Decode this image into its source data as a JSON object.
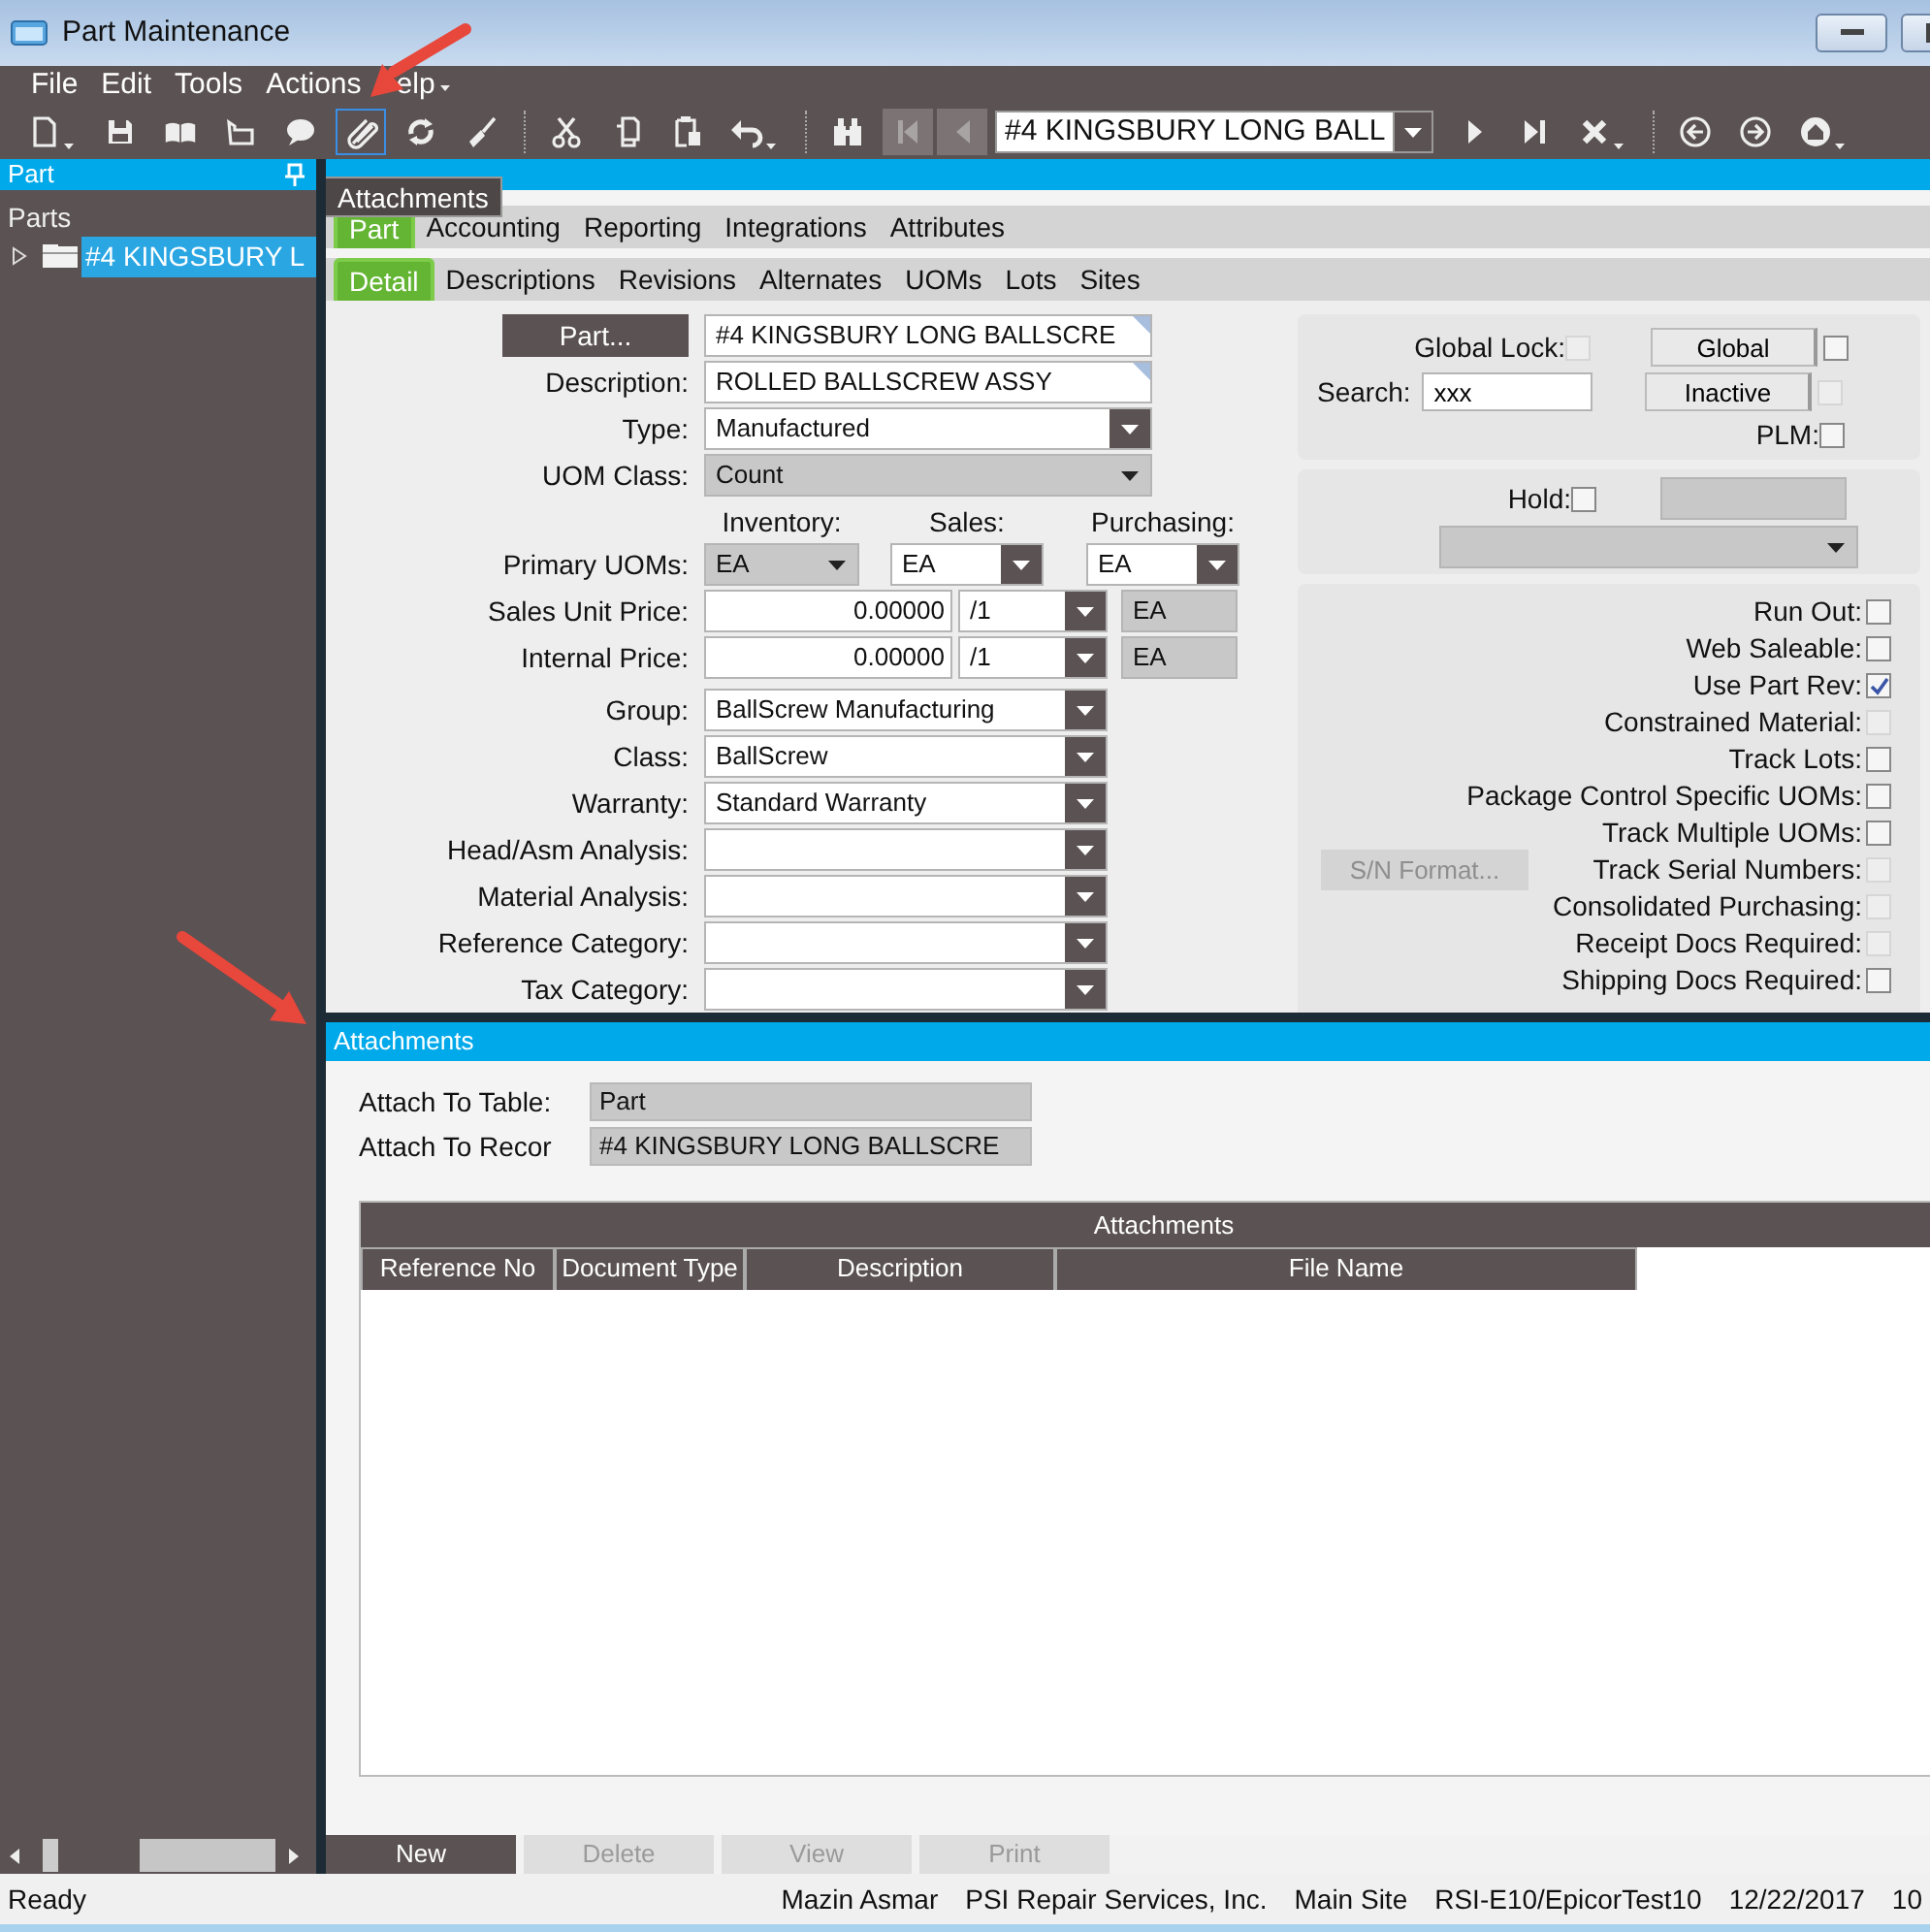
{
  "window": {
    "title": "Part Maintenance"
  },
  "menu": [
    "File",
    "Edit",
    "Tools",
    "Actions",
    "elp"
  ],
  "toolbar": {
    "tooltip": "Attachments",
    "groups": [
      [
        {
          "kind": "new",
          "has_menu": true,
          "selected": false,
          "disabled": false
        },
        {
          "kind": "save",
          "has_menu": false,
          "selected": false,
          "disabled": false
        },
        {
          "kind": "book",
          "has_menu": false,
          "selected": false,
          "disabled": false
        },
        {
          "kind": "folder",
          "has_menu": false,
          "selected": false,
          "disabled": false
        },
        {
          "kind": "comment",
          "has_menu": false,
          "selected": false,
          "disabled": false
        },
        {
          "kind": "attach",
          "has_menu": false,
          "selected": true,
          "disabled": false
        },
        {
          "kind": "refresh",
          "has_menu": false,
          "selected": false,
          "disabled": false
        },
        {
          "kind": "clear",
          "has_menu": false,
          "selected": false,
          "disabled": false
        }
      ],
      [
        {
          "kind": "cut",
          "has_menu": false,
          "selected": false,
          "disabled": false
        },
        {
          "kind": "copy",
          "has_menu": false,
          "selected": false,
          "disabled": false
        },
        {
          "kind": "paste",
          "has_menu": false,
          "selected": false,
          "disabled": false
        },
        {
          "kind": "undo",
          "has_menu": true,
          "selected": false,
          "disabled": false
        }
      ],
      [
        {
          "kind": "search",
          "has_menu": false,
          "selected": false,
          "disabled": false
        },
        {
          "kind": "first",
          "has_menu": false,
          "selected": false,
          "disabled": true
        },
        {
          "kind": "prev",
          "has_menu": false,
          "selected": false,
          "disabled": true
        },
        {
          "kind": "record",
          "value": "#4 KINGSBURY LONG BALL"
        },
        {
          "kind": "next",
          "has_menu": false,
          "selected": false,
          "disabled": false
        },
        {
          "kind": "last",
          "has_menu": false,
          "selected": false,
          "disabled": false
        },
        {
          "kind": "delete",
          "has_menu": true,
          "selected": false,
          "disabled": false
        }
      ],
      [
        {
          "kind": "back",
          "has_menu": false,
          "selected": false,
          "disabled": false
        },
        {
          "kind": "forward",
          "has_menu": false,
          "selected": false,
          "disabled": false
        },
        {
          "kind": "home",
          "has_menu": true,
          "selected": false,
          "disabled": false
        }
      ]
    ]
  },
  "sidebar": {
    "title": "Part",
    "tree_title": "Parts",
    "tree": [
      {
        "label": "#4 KINGSBURY L",
        "selected": true,
        "expanded": false
      }
    ]
  },
  "form": {
    "tabs": [
      {
        "label": "Part",
        "selected": true
      },
      {
        "label": "Accounting",
        "selected": false
      },
      {
        "label": "Reporting",
        "selected": false
      },
      {
        "label": "Integrations",
        "selected": false
      },
      {
        "label": "Attributes",
        "selected": false
      }
    ],
    "subtabs": [
      {
        "label": "Detail",
        "selected": true
      },
      {
        "label": "Descriptions",
        "selected": false
      },
      {
        "label": "Revisions",
        "selected": false
      },
      {
        "label": "Alternates",
        "selected": false
      },
      {
        "label": "UOMs",
        "selected": false
      },
      {
        "label": "Lots",
        "selected": false
      },
      {
        "label": "Sites",
        "selected": false
      }
    ],
    "fields": [
      {
        "kind": "button",
        "label": "Part...",
        "value": "#4 KINGSBURY LONG BALLSCRE"
      },
      {
        "kind": "text",
        "label": "Description:",
        "value": "ROLLED BALLSCREW ASSY"
      },
      {
        "kind": "combo",
        "label": "Type:",
        "value": "Manufactured"
      },
      {
        "kind": "readonly-combo",
        "label": "UOM Class:",
        "value": "Count"
      }
    ],
    "uoms": {
      "label": "Primary UOMs:",
      "columns": [
        {
          "heading": "Inventory:",
          "value": "EA",
          "readonly": true
        },
        {
          "heading": "Sales:",
          "value": "EA",
          "readonly": false
        },
        {
          "heading": "Purchasing:",
          "value": "EA",
          "readonly": false
        }
      ]
    },
    "prices": [
      {
        "label": "Sales Unit Price:",
        "amount": "0.00000",
        "per": "/1",
        "uom": "EA"
      },
      {
        "label": "Internal Price:",
        "amount": "0.00000",
        "per": "/1",
        "uom": "EA"
      }
    ],
    "more_fields": [
      {
        "kind": "combo",
        "label": "Group:",
        "value": "BallScrew Manufacturing"
      },
      {
        "kind": "combo",
        "label": "Class:",
        "value": "BallScrew"
      },
      {
        "kind": "combo",
        "label": "Warranty:",
        "value": "Standard Warranty"
      },
      {
        "kind": "combo",
        "label": "Head/Asm Analysis:"
      },
      {
        "kind": "combo",
        "label": "Material Analysis:"
      },
      {
        "kind": "combo",
        "label": "Reference Category:"
      },
      {
        "kind": "combo",
        "label": "Tax Category:"
      }
    ],
    "global_lock": {
      "label": "Global Lock:",
      "checked": false,
      "disabled": true
    },
    "search": {
      "label": "Search:",
      "value": "xxx"
    },
    "toggles": [
      {
        "label": "Global",
        "checked": false,
        "disabled": false
      },
      {
        "label": "Inactive",
        "checked": false,
        "disabled": true
      }
    ],
    "plm": {
      "label": "PLM:",
      "checked": false,
      "disabled": false
    },
    "hold": {
      "label": "Hold:",
      "checked": false,
      "disabled": false
    },
    "sn_button": {
      "label": "S/N Format...",
      "disabled": true
    },
    "flags": [
      {
        "label": "Run Out:",
        "checked": false,
        "disabled": false
      },
      {
        "label": "Web Saleable:",
        "checked": false,
        "disabled": false
      },
      {
        "label": "Use Part Rev:",
        "checked": true,
        "disabled": false
      },
      {
        "label": "Constrained Material:",
        "checked": false,
        "disabled": true
      },
      {
        "label": "Track Lots:",
        "checked": false,
        "disabled": false
      },
      {
        "label": "Package Control Specific UOMs:",
        "checked": false,
        "disabled": false
      },
      {
        "label": "Track Multiple UOMs:",
        "checked": false,
        "disabled": false
      },
      {
        "label": "Track Serial Numbers:",
        "checked": false,
        "disabled": true
      },
      {
        "label": "Consolidated Purchasing:",
        "checked": false,
        "disabled": true
      },
      {
        "label": "Receipt Docs Required:",
        "checked": false,
        "disabled": true
      },
      {
        "label": "Shipping Docs Required:",
        "checked": false,
        "disabled": false
      }
    ]
  },
  "attachments": {
    "title": "Attachments",
    "fields": [
      {
        "label": "Attach To Table:",
        "value": "Part"
      },
      {
        "label": "Attach To Recor",
        "value": "#4 KINGSBURY LONG BALLSCRE"
      }
    ],
    "grid": {
      "title": "Attachments",
      "columns": [
        "Reference No",
        "Document Type",
        "Description",
        "File Name"
      ]
    },
    "buttons": [
      {
        "label": "New",
        "disabled": false
      },
      {
        "label": "Delete",
        "disabled": true
      },
      {
        "label": "View",
        "disabled": true
      },
      {
        "label": "Print",
        "disabled": true
      }
    ]
  },
  "status_bar": {
    "message": "Ready",
    "items": [
      "Mazin Asmar",
      "PSI Repair Services, Inc.",
      "Main Site",
      "RSI-E10/EpicorTest10",
      "12/22/2017",
      "10"
    ]
  }
}
